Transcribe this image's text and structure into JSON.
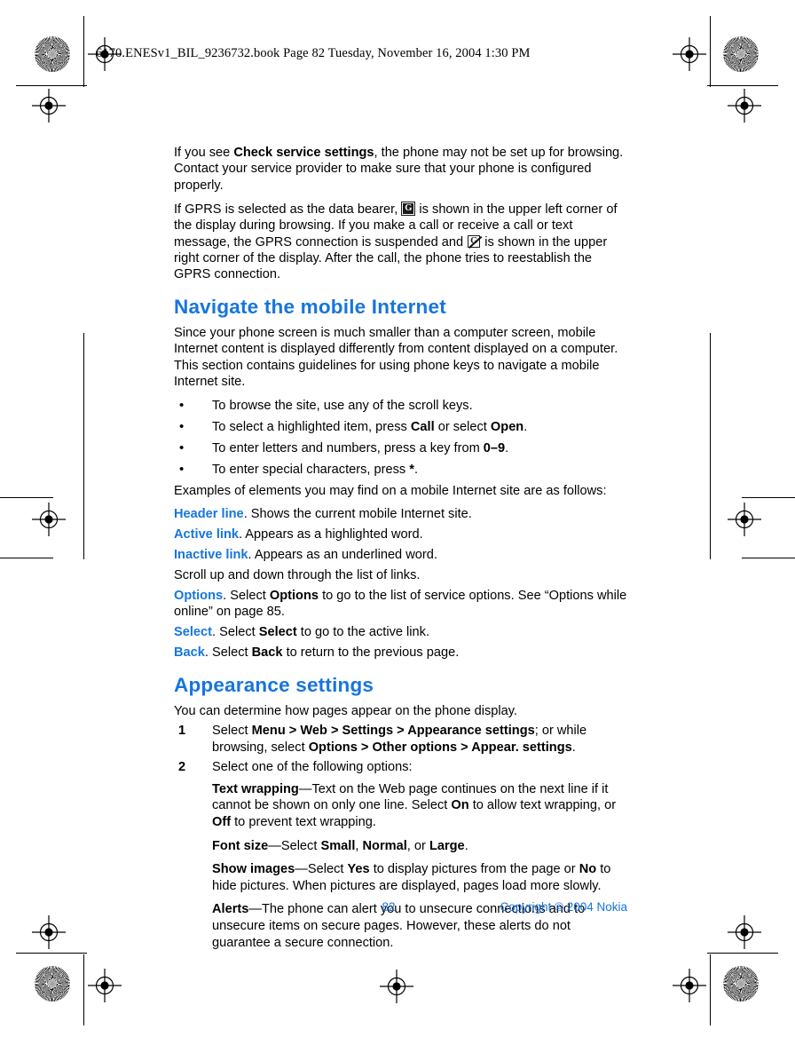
{
  "doc": {
    "header_line": "6170.ENESv1_BIL_9236732.book  Page 82  Tuesday, November 16, 2004  1:30 PM",
    "accent_blue": "#1675dd",
    "body_black": "#000000"
  },
  "intro": {
    "p1_before": "If you see ",
    "p1_bold": "Check service settings",
    "p1_after": ", the phone may not be set up for browsing. Contact your service provider to make sure that your phone is configured properly.",
    "p2_a": "If GPRS is selected as the data bearer,",
    "p2_icon1_name": "gprs-active-icon",
    "p2_icon1_glyph": "G",
    "p2_b": "is shown in the upper left corner of the display during browsing. If you make a call or receive a call or text message, the GPRS connection is suspended and",
    "p2_icon2_name": "gprs-suspended-icon",
    "p2_icon2_glyph": "G",
    "p2_c": "is shown in the upper right corner of the display. After the call, the phone tries to reestablish the GPRS connection."
  },
  "navigate": {
    "heading": "Navigate the mobile Internet",
    "intro": "Since your phone screen is much smaller than a computer screen, mobile Internet content is displayed differently from content displayed on a computer. This section contains guidelines for using phone keys to navigate a mobile Internet site.",
    "bullet_char": "•",
    "bullets": [
      {
        "pre": "To browse the site, use any of the scroll keys.",
        "bold1": "",
        "mid": "",
        "bold2": "",
        "post": ""
      },
      {
        "pre": "To select a highlighted item, press ",
        "bold1": "Call",
        "mid": " or select ",
        "bold2": "Open",
        "post": "."
      },
      {
        "pre": "To enter letters and numbers, press a key from ",
        "bold1": "0–9",
        "mid": "",
        "bold2": "",
        "post": "."
      },
      {
        "pre": "To enter special characters, press ",
        "bold1": "*",
        "mid": "",
        "bold2": "",
        "post": "."
      }
    ],
    "examples_lead": "Examples of elements you may find on a mobile Internet site are as follows:",
    "definitions": [
      {
        "term": "Header line",
        "rest_pre": ". Shows the current mobile Internet site.",
        "bold": "",
        "rest_post": ""
      },
      {
        "term": "Active link",
        "rest_pre": ". Appears as a highlighted word.",
        "bold": "",
        "rest_post": ""
      },
      {
        "term": "Inactive link",
        "rest_pre": ". Appears as an underlined word.",
        "bold": "",
        "rest_post": ""
      }
    ],
    "scroll_note": "Scroll up and down through the list of links.",
    "definitions2": [
      {
        "term": "Options",
        "rest_pre": ". Select ",
        "bold": "Options",
        "rest_post": " to go to the list of service options. See “Options while online” on page 85."
      },
      {
        "term": "Select",
        "rest_pre": ". Select ",
        "bold": "Select",
        "rest_post": " to go to the active link."
      },
      {
        "term": "Back",
        "rest_pre": ". Select ",
        "bold": "Back",
        "rest_post": " to return to the previous page."
      }
    ]
  },
  "appearance": {
    "heading": "Appearance settings",
    "intro": "You can determine how pages appear on the phone display.",
    "steps": [
      {
        "num": "1",
        "pre": "Select ",
        "bold1": "Menu > Web > Settings > Appearance settings",
        "mid": "; or while browsing, select ",
        "bold2": "Options > Other options > Appear. settings",
        "post": "."
      },
      {
        "num": "2",
        "pre": "Select one of the following options:",
        "bold1": "",
        "mid": "",
        "bold2": "",
        "post": ""
      }
    ],
    "options": [
      {
        "term": "Text wrapping",
        "a": "—Text on the Web page continues on the next line if it cannot be shown on only one line. Select ",
        "b1": "On",
        "c": " to allow text wrapping, or ",
        "b2": "Off",
        "d": " to prevent text wrapping."
      },
      {
        "term": "Font size",
        "a": "—Select ",
        "b1": "Small",
        "c": ", ",
        "b2": "Normal",
        "d": ", or ",
        "b3": "Large",
        "e": "."
      },
      {
        "term": "Show images",
        "a": "—Select ",
        "b1": "Yes",
        "c": " to display pictures from the page or ",
        "b2": "No",
        "d": " to hide pictures. When pictures are displayed, pages load more slowly."
      },
      {
        "term": "Alerts",
        "a": "—The phone can alert you to unsecure connections and to unsecure items on secure pages. However, these alerts do not guarantee a secure connection.",
        "b1": "",
        "c": "",
        "b2": "",
        "d": ""
      }
    ]
  },
  "footer": {
    "page_number": "82",
    "copyright": "Copyright © 2004 Nokia"
  }
}
